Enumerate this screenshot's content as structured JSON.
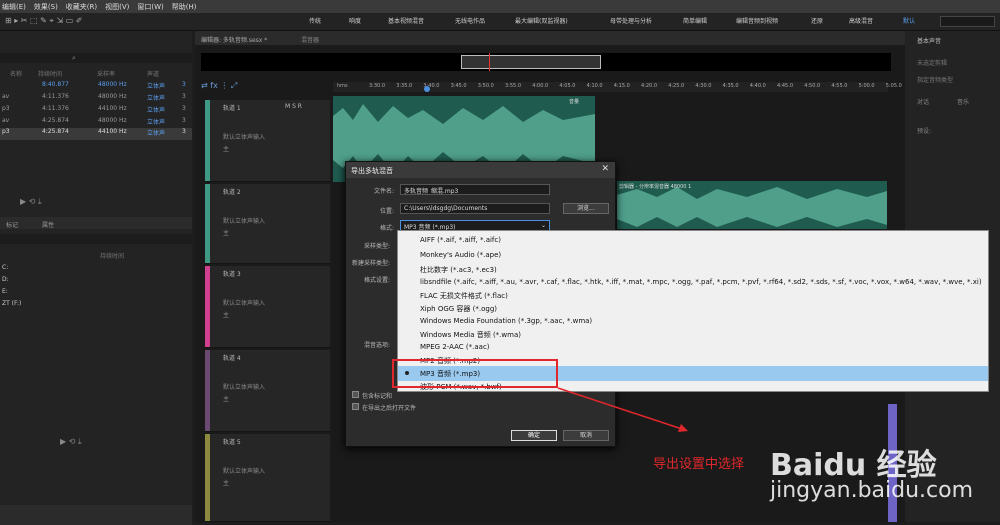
{
  "menu": [
    "编辑(E)",
    "效果(S)",
    "收藏夹(R)",
    "视图(V)",
    "窗口(W)",
    "帮助(H)"
  ],
  "workspaces": [
    "传统",
    "响度",
    "基本视频混音",
    "无线电作品",
    "最大编辑(双监视器)",
    "母带处理与分析",
    "简单编辑",
    "编辑音频到视频",
    "还原",
    "高级混音",
    "默认"
  ],
  "workspace_active": "默认",
  "editor_tabs": [
    "编辑器: 多轨音频.sesx *",
    "混音器"
  ],
  "right_panel": {
    "title": "基本声音",
    "items": [
      "未选定剪辑",
      "指定音频类型",
      "对话",
      "音乐",
      "预设:"
    ]
  },
  "files": {
    "headers": [
      "名称",
      "持续时间",
      "采样率",
      "声道"
    ],
    "rows": [
      {
        "name": "",
        "duration": "8:40.877",
        "rate": "48000 Hz",
        "ch": "立体声",
        "n": "3"
      },
      {
        "name": "av",
        "duration": "4:11.376",
        "rate": "48000 Hz",
        "ch": "立体声",
        "n": "3"
      },
      {
        "name": "p3",
        "duration": "4:11.376",
        "rate": "44100 Hz",
        "ch": "立体声",
        "n": "3"
      },
      {
        "name": "av",
        "duration": "4:25.874",
        "rate": "48000 Hz",
        "ch": "立体声",
        "n": "3"
      },
      {
        "name": "p3",
        "duration": "4:25.874",
        "rate": "44100 Hz",
        "ch": "立体声",
        "n": "3"
      }
    ]
  },
  "media": {
    "tabs": [
      "标记",
      "属性"
    ],
    "drives": [
      "C:",
      "D:",
      "E:",
      "ZT (F:)"
    ],
    "col": "持续时间"
  },
  "timeline": {
    "ruler": [
      "hms",
      "3:30.0",
      "3:35.0",
      "3:40.0",
      "3:45.0",
      "3:50.0",
      "3:55.0",
      "4:00.0",
      "4:05.0",
      "4:10.0",
      "4:15.0",
      "4:20.0",
      "4:25.0",
      "4:30.0",
      "4:35.0",
      "4:40.0",
      "4:45.0",
      "4:50.0",
      "4:55.0",
      "5:00.0",
      "5:05.0"
    ],
    "clip1": "音量",
    "clip2": "剪辑器 - 分辨率混音器 48000 1"
  },
  "tracks": [
    {
      "name": "轨道 1",
      "input": "默认立体声输入",
      "out": "主",
      "color": "#3f9a83"
    },
    {
      "name": "轨道 2",
      "input": "默认立体声输入",
      "out": "主",
      "color": "#3f9a83"
    },
    {
      "name": "轨道 3",
      "input": "默认立体声输入",
      "out": "主",
      "color": "#d0408e"
    },
    {
      "name": "轨道 4",
      "input": "默认立体声输入",
      "out": "主",
      "color": "#6b4a72"
    },
    {
      "name": "轨道 5",
      "input": "默认立体声输入",
      "out": "主",
      "color": "#8c8a3e"
    }
  ],
  "dialog": {
    "title": "导出多轨混音",
    "filename_label": "文件名:",
    "filename": "多轨音频_缩混.mp3",
    "location_label": "位置:",
    "location": "C:\\Users\\ldsgdg\\Documents",
    "browse": "浏览...",
    "format_label": "格式:",
    "format": "MP3 音频 (*.mp3)",
    "labels": [
      "采样类型:",
      "新建采样类型:",
      "格式设置:",
      "混音选项:"
    ],
    "checkbox1": "包含标记和",
    "checkbox2": "在导出之后打开文件",
    "ok": "确定",
    "cancel": "取消"
  },
  "format_options": [
    "AIFF (*.aif, *.aiff, *.aifc)",
    "Monkey's Audio (*.ape)",
    "杜比数字 (*.ac3, *.ec3)",
    "libsndfile (*.aifc, *.aiff, *.au, *.avr, *.caf, *.flac, *.htk, *.iff, *.mat, *.mpc, *.ogg, *.paf, *.pcm, *.pvf, *.rf64, *.sd2, *.sds, *.sf, *.voc, *.vox, *.w64, *.wav, *.wve, *.xi)",
    "FLAC 无损文件格式 (*.flac)",
    "Xiph OGG 容器 (*.ogg)",
    "Windows Media Foundation (*.3gp, *.aac, *.wma)",
    "Windows Media 音频 (*.wma)",
    "MPEG 2-AAC (*.aac)",
    "MP2 音频 (*.mp2)",
    "MP3 音频 (*.mp3)",
    "波形 PCM (*.wav, *.bwf)"
  ],
  "selected_option_index": 10,
  "annotation": "导出设置中选择",
  "watermark": {
    "line1": "Baidu 经验",
    "line2": "jingyan.baidu.com"
  }
}
